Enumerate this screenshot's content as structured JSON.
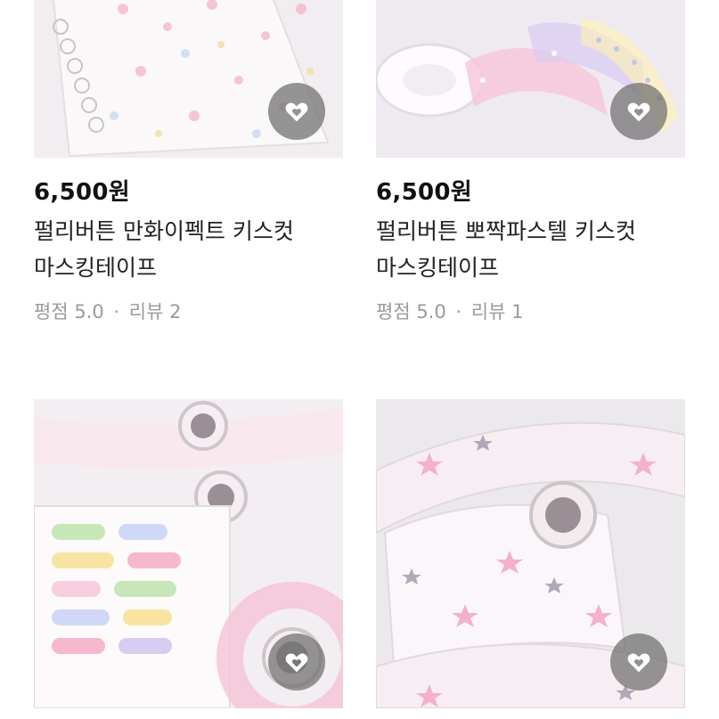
{
  "products": [
    {
      "price": "6,500원",
      "title_line1": "펄리버튼 만화이펙트 키스컷",
      "title_line2": "마스킹테이프",
      "rating_label": "평점 5.0",
      "separator": "·",
      "review_label": "리뷰 2",
      "like_icon": "heart-outline-icon"
    },
    {
      "price": "6,500원",
      "title_line1": "펄리버튼 뽀짝파스텔 키스컷",
      "title_line2": "마스킹테이프",
      "rating_label": "평점 5.0",
      "separator": "·",
      "review_label": "리뷰 1",
      "like_icon": "heart-outline-icon"
    },
    {
      "like_icon": "heart-outline-icon"
    },
    {
      "like_icon": "heart-outline-icon"
    }
  ],
  "colors": {
    "like_button_bg": "#6e6e6e",
    "price_text": "#111111",
    "meta_text": "#9a9a9a",
    "thumb_bg": "#f3eef1",
    "pink_accent": "#f3a9c8"
  }
}
